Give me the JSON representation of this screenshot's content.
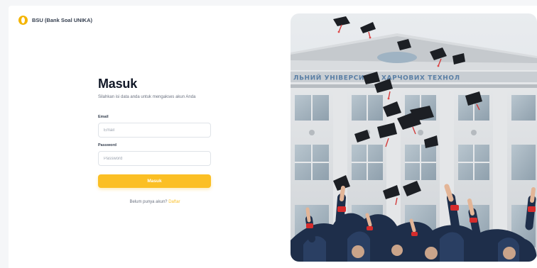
{
  "brand": {
    "name": "BSU (Bank Soal UNIKA)",
    "logo_icon": "brand-logo-icon",
    "accent": "#fbbf24"
  },
  "login": {
    "title": "Masuk",
    "subtitle": "Silahkan isi data anda untuk mengakses akun Anda",
    "email_label": "Email",
    "email_placeholder": "Email",
    "email_value": "",
    "password_label": "Password",
    "password_placeholder": "Password",
    "password_value": "",
    "submit_label": "Masuk",
    "register_prompt": "Belum punya akun?",
    "register_link": "Daftar"
  },
  "hero": {
    "sign_text": "ЛЬНИЙ УНІВЕРСИТЕТ ХАРЧОВИХ ТЕХНОЛ"
  }
}
